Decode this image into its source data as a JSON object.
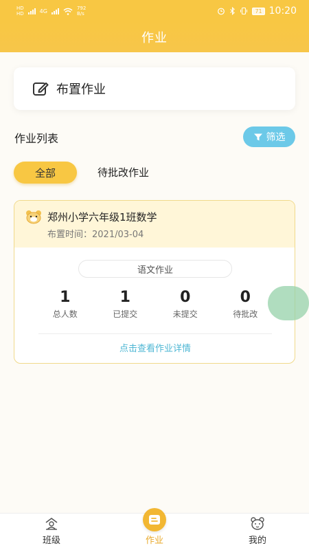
{
  "status_bar": {
    "sim1": "HD",
    "sim2": "HD",
    "network": "4G",
    "speed_value": "792",
    "speed_unit": "B/s",
    "battery": "71",
    "time": "10:20"
  },
  "nav": {
    "title": "作业"
  },
  "assign": {
    "label": "布置作业",
    "icon": "edit-icon"
  },
  "list": {
    "title": "作业列表",
    "filter_label": "筛选",
    "tabs": [
      {
        "label": "全部",
        "selected": true
      },
      {
        "label": "待批改作业",
        "selected": false
      }
    ]
  },
  "homework": {
    "class_name": "郑州小学六年级1班数学",
    "date_label": "布置时间：",
    "date": "2021/03-04",
    "type": "语文作业",
    "stats": [
      {
        "value": "1",
        "label": "总人数"
      },
      {
        "value": "1",
        "label": "已提交"
      },
      {
        "value": "0",
        "label": "未提交"
      },
      {
        "value": "0",
        "label": "待批改"
      }
    ],
    "detail_link": "点击查看作业详情"
  },
  "tab_bar": {
    "items": [
      {
        "label": "班级",
        "icon": "class-icon",
        "active": false
      },
      {
        "label": "作业",
        "icon": "homework-icon",
        "active": true
      },
      {
        "label": "我的",
        "icon": "profile-icon",
        "active": false
      }
    ]
  },
  "colors": {
    "primary": "#f8c743",
    "accent_blue": "#6cc9e8",
    "link": "#4fb7d4",
    "active_tab": "#e8a92b"
  }
}
